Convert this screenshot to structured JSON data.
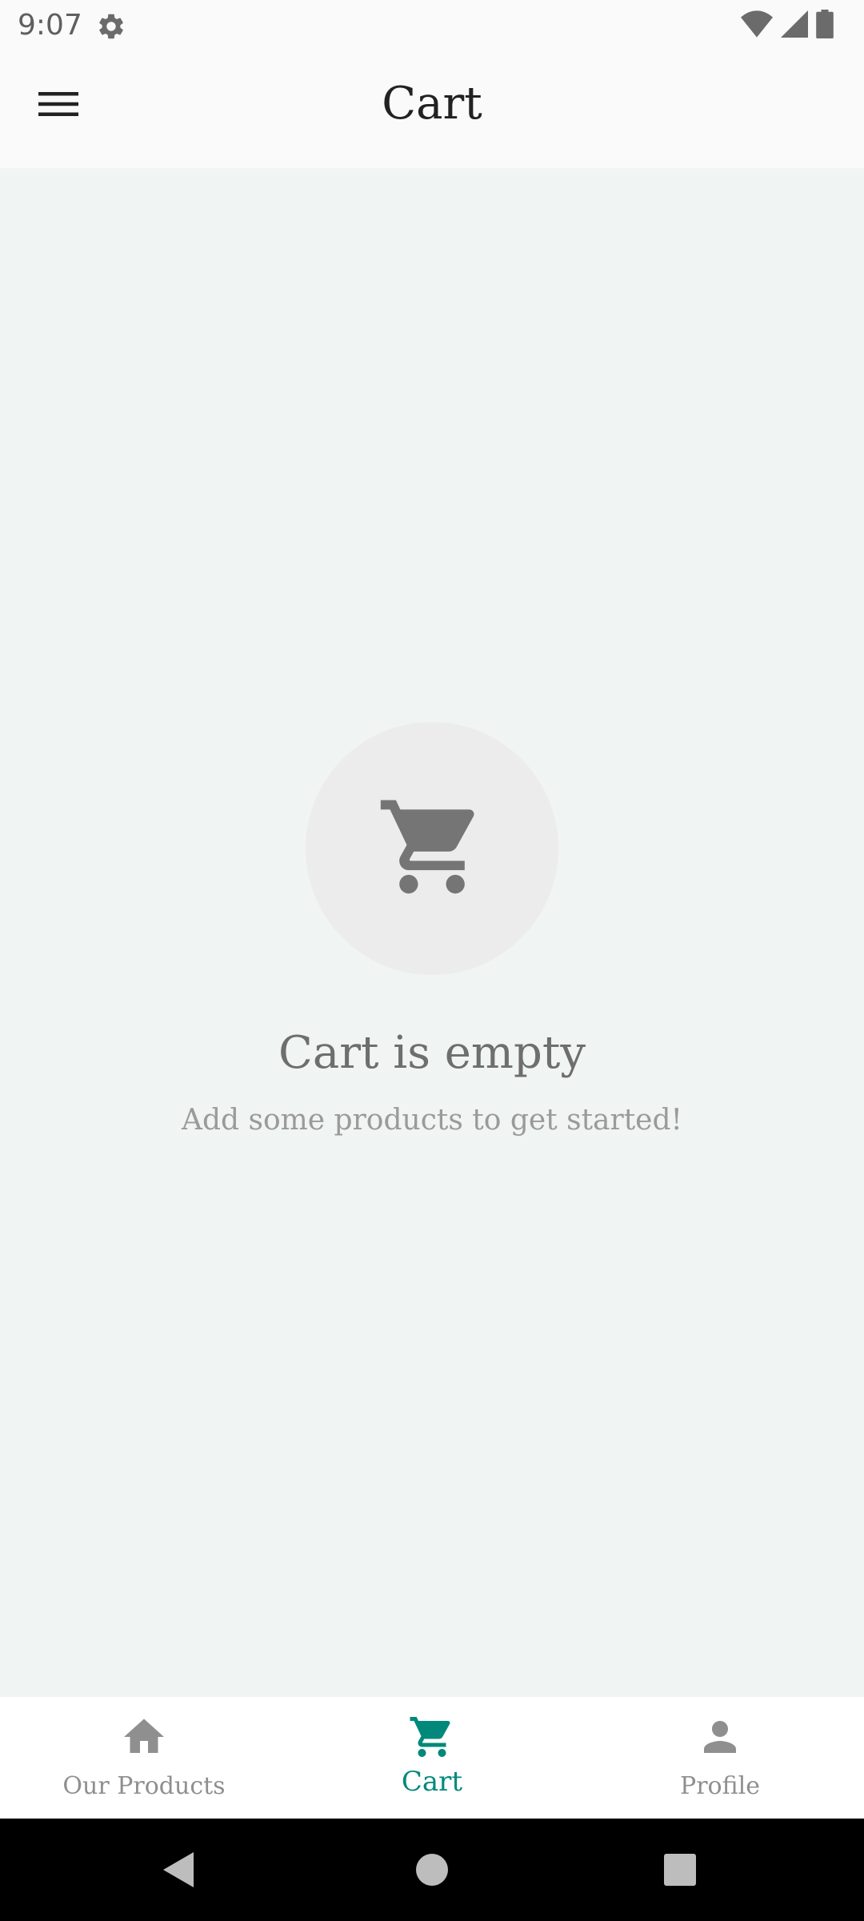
{
  "status_bar": {
    "time": "9:07",
    "icons": [
      "settings-icon",
      "wifi-icon",
      "signal-icon",
      "battery-icon"
    ]
  },
  "app_bar": {
    "title": "Cart",
    "menu_icon": "hamburger-menu-icon"
  },
  "empty_state": {
    "icon": "shopping-cart-icon",
    "title": "Cart is empty",
    "subtitle": "Add some products to get started!"
  },
  "bottom_nav": {
    "items": [
      {
        "label": "Our Products",
        "icon": "home-icon",
        "active": false
      },
      {
        "label": "Cart",
        "icon": "cart-icon",
        "active": true
      },
      {
        "label": "Profile",
        "icon": "person-icon",
        "active": false
      }
    ]
  },
  "system_nav": {
    "buttons": [
      "back-icon",
      "home-circle-icon",
      "recents-icon"
    ]
  },
  "colors": {
    "accent": "#00897b",
    "background": "#f0f4f3",
    "bar_background": "#fafafa",
    "icon_gray": "#757575",
    "inactive_label": "#8f8f8f"
  }
}
